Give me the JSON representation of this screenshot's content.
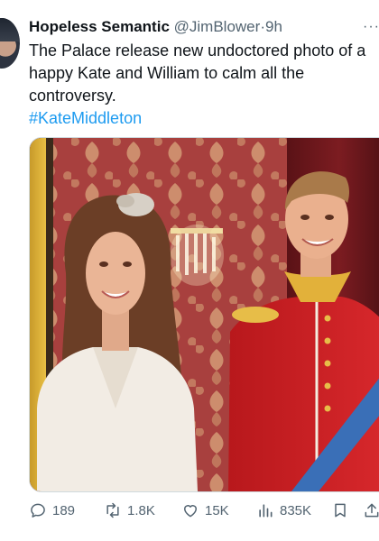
{
  "author": {
    "display_name": "Hopeless Semantic",
    "handle": "@JimBlower",
    "separator": "·",
    "time": "9h",
    "more_label": "···"
  },
  "post": {
    "text_lines": [
      "The Palace release new undoctored photo of a",
      "happy Kate and William to calm all the",
      "controversy."
    ],
    "hashtag": "#KateMiddleton"
  },
  "metrics": {
    "replies": "189",
    "reposts": "1.8K",
    "likes": "15K",
    "views": "835K"
  },
  "icons": {
    "reply": "speech-bubble-icon",
    "repost": "retweet-icon",
    "like": "heart-icon",
    "views": "bar-chart-icon",
    "bookmark": "bookmark-icon",
    "share": "share-icon"
  },
  "colors": {
    "text": "#0f1419",
    "secondary": "#536471",
    "link": "#1d9bf0"
  }
}
